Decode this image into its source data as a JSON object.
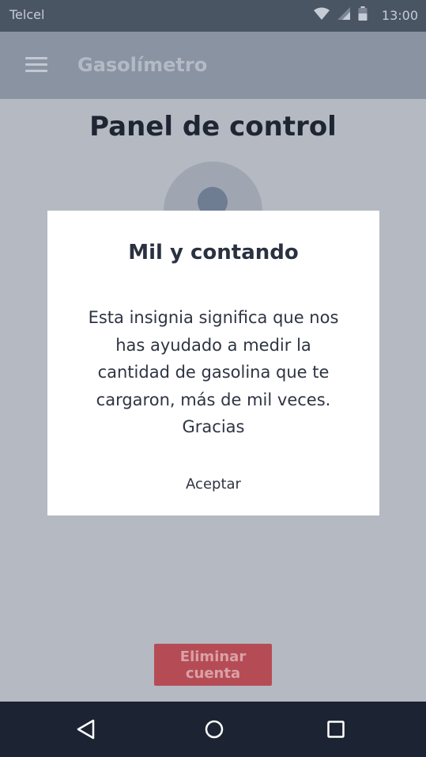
{
  "status_bar": {
    "carrier": "Telcel",
    "time": "13:00",
    "icons": [
      "wifi-icon",
      "signal-icon",
      "battery-icon"
    ]
  },
  "app_bar": {
    "menu_icon": "hamburger-menu-icon",
    "title": "Gasolímetro"
  },
  "page": {
    "title": "Panel de control",
    "delete_account_label": "Eliminar cuenta"
  },
  "dialog": {
    "title": "Mil y contando",
    "message_lines": [
      "Esta insignia significa que nos",
      "has ayudado a medir la",
      "cantidad de gasolina que te",
      "cargaron, más de mil veces.",
      "Gracias"
    ],
    "accept_label": "Aceptar"
  },
  "nav_bar": {
    "icons": [
      "back-icon",
      "home-icon",
      "recent-apps-icon"
    ]
  },
  "colors": {
    "status_bar_bg": "#4a5564",
    "app_bar_bg": "#8993a2",
    "page_bg_scrimmed": "#b5b9c1",
    "delete_button_bg": "#b54c55",
    "nav_bar_bg": "#1c2433",
    "dialog_bg": "#ffffff"
  }
}
